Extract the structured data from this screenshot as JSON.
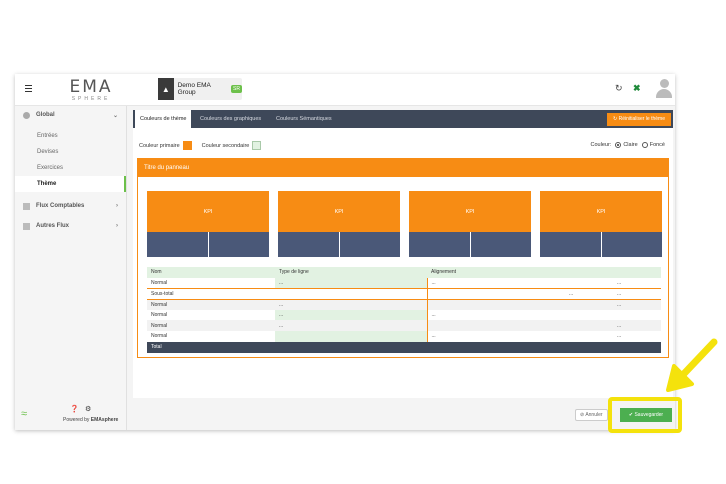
{
  "topbar": {
    "logo_main": "EMA",
    "logo_sub": "SPHERE",
    "company_name": "Demo EMA Group",
    "company_badge": "SR"
  },
  "sidebar": {
    "global_label": "Global",
    "sub_items": [
      {
        "label": "Entrées",
        "active": false
      },
      {
        "label": "Devises",
        "active": false
      },
      {
        "label": "Exercices",
        "active": false
      },
      {
        "label": "Thème",
        "active": true
      }
    ],
    "categories": [
      {
        "label": "Flux Comptables"
      },
      {
        "label": "Autres Flux"
      }
    ],
    "powered_prefix": "Powered by ",
    "powered_brand": "EMAsphere"
  },
  "tabs": [
    {
      "label": "Couleurs de thème",
      "active": true
    },
    {
      "label": "Couleurs des graphiques",
      "active": false
    },
    {
      "label": "Couleurs Sémantiques",
      "active": false
    }
  ],
  "reset_label": "Réinitialiser le thème",
  "colors": {
    "primary_label": "Couleur primaire",
    "secondary_label": "Couleur secondaire",
    "primary": "#f78c14",
    "secondary": "#e2f2e2",
    "dark": "#3e4859",
    "kpi_bottom": "#4a5878",
    "accent_green": "#4caf50",
    "highlight": "#f4e20c"
  },
  "mode": {
    "label": "Couleur:",
    "options": [
      {
        "label": "Claire",
        "selected": true
      },
      {
        "label": "Foncé",
        "selected": false
      }
    ]
  },
  "panel": {
    "title": "Titre du panneau",
    "kpis": [
      "KPI",
      "KPI",
      "KPI",
      "KPI"
    ],
    "table": {
      "headers": [
        "Nom",
        "Type de ligne",
        "Alignement"
      ],
      "rows": [
        {
          "name": "Normal",
          "type": "...",
          "align": "...",
          "c4": "",
          "c5": "..."
        },
        {
          "name": "Sous-total",
          "type": "",
          "align": "",
          "c4": "...",
          "c5": "..."
        },
        {
          "name": "Normal",
          "type": "...",
          "align": "",
          "c4": "",
          "c5": "..."
        },
        {
          "name": "Normal",
          "type": "...",
          "align": "...",
          "c4": "",
          "c5": ""
        },
        {
          "name": "Normal",
          "type": "...",
          "align": "",
          "c4": "",
          "c5": "..."
        },
        {
          "name": "Normal",
          "type": "",
          "align": "...",
          "c4": "",
          "c5": "..."
        }
      ],
      "total_label": "Total"
    }
  },
  "footer": {
    "cancel_label": "Annuler",
    "save_label": "Sauvegarder"
  }
}
